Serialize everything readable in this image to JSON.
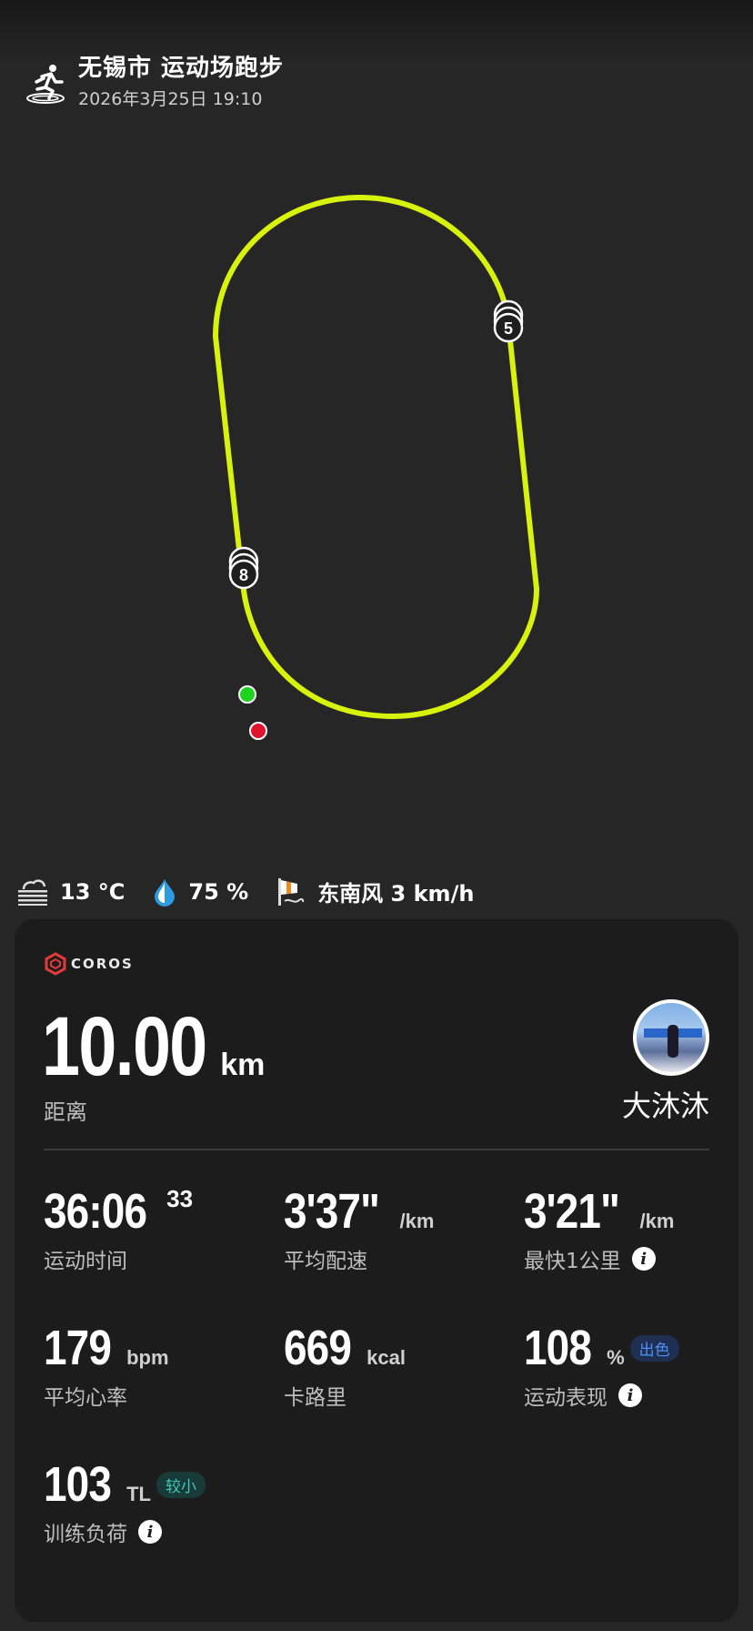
{
  "header": {
    "title": "无锡市 运动场跑步",
    "datetime": "2026年3月25日 19:10"
  },
  "map": {
    "markers": [
      {
        "label": "5"
      },
      {
        "label": "8"
      }
    ],
    "track_color": "#d9f20d",
    "start_color": "#1fd21f",
    "end_color": "#e0142c"
  },
  "weather": {
    "temperature": "13 °C",
    "humidity": "75 %",
    "wind": "东南风 3 km/h"
  },
  "card": {
    "brand": "COROS",
    "distance": {
      "value": "10.00",
      "unit": "km",
      "label": "距离"
    },
    "user": {
      "name": "大沐沐"
    },
    "stats": {
      "time": {
        "value": "36:06",
        "sup": "33",
        "label": "运动时间"
      },
      "avg_pace": {
        "value": "3'37\"",
        "unit": "/km",
        "label": "平均配速"
      },
      "fastest_km": {
        "value": "3'21\"",
        "unit": "/km",
        "label": "最快1公里"
      },
      "avg_hr": {
        "value": "179",
        "unit": "bpm",
        "label": "平均心率"
      },
      "calories": {
        "value": "669",
        "unit": "kcal",
        "label": "卡路里"
      },
      "performance": {
        "value": "108",
        "unit": "%",
        "badge": "出色",
        "label": "运动表现"
      },
      "training_load": {
        "value": "103",
        "unit": "TL",
        "badge": "较小",
        "label": "训练负荷"
      }
    }
  }
}
